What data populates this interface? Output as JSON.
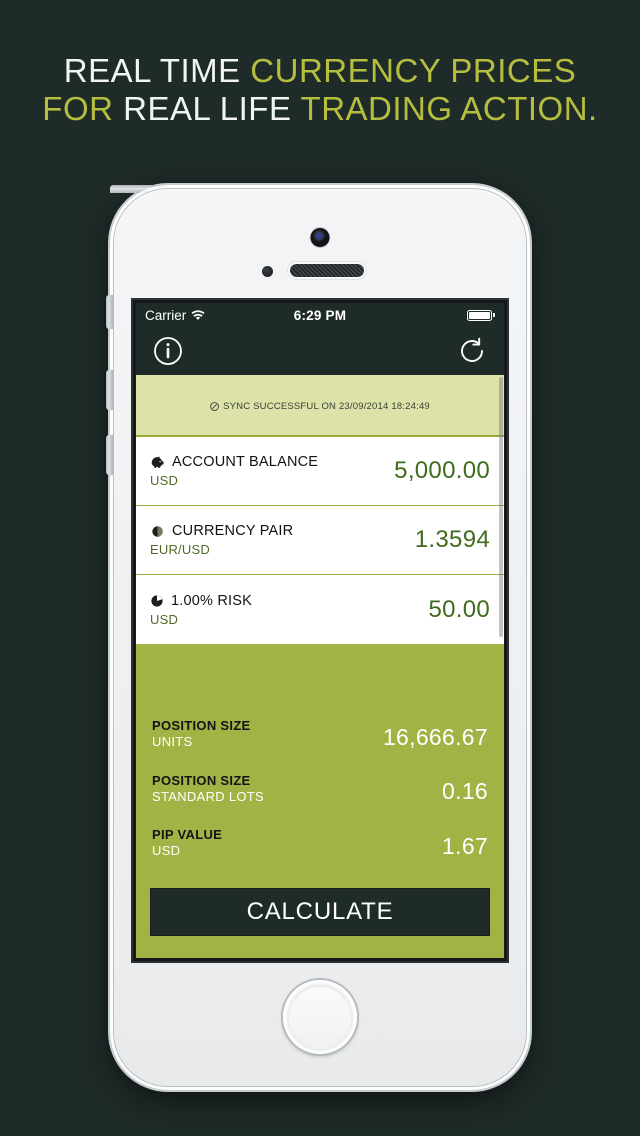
{
  "headline": {
    "line1": [
      {
        "text": "REAL TIME ",
        "color": "white"
      },
      {
        "text": "CURRENCY PRICES",
        "color": "green"
      }
    ],
    "line2": [
      {
        "text": "FOR ",
        "color": "green"
      },
      {
        "text": "REAL LIFE ",
        "color": "white"
      },
      {
        "text": "TRADING ACTION.",
        "color": "green"
      }
    ],
    "line1_plain": "REAL TIME CURRENCY PRICES",
    "line2_plain": "FOR REAL LIFE TRADING ACTION."
  },
  "colors": {
    "background": "#1f2b29",
    "accent_green": "#b5be3e",
    "panel_green": "#a3b244",
    "banner_green": "#dce2a8",
    "value_green": "#3f6b1f",
    "white": "#ffffff"
  },
  "statusbar": {
    "carrier": "Carrier",
    "wifi_icon": "wifi-icon",
    "time": "6:29 PM",
    "battery_icon": "battery-full-icon"
  },
  "navbar": {
    "info_icon": "info-circle-icon",
    "refresh_icon": "refresh-icon"
  },
  "sync": {
    "status_icon": "check-circle-icon",
    "message": "SYNC SUCCESSFUL ON 23/09/2014 18:24:49"
  },
  "inputs": [
    {
      "icon": "piggy-bank-icon",
      "title": "ACCOUNT BALANCE",
      "subtitle": "USD",
      "value": "5,000.00"
    },
    {
      "icon": "currency-circle-icon",
      "title": "CURRENCY PAIR",
      "subtitle": "EUR/USD",
      "value": "1.3594"
    },
    {
      "icon": "pie-chart-icon",
      "title": "1.00% RISK",
      "subtitle": "USD",
      "value": "50.00"
    }
  ],
  "results": [
    {
      "title": "POSITION SIZE",
      "subtitle": "UNITS",
      "value": "16,666.67"
    },
    {
      "title": "POSITION SIZE",
      "subtitle": "STANDARD LOTS",
      "value": "0.16"
    },
    {
      "title": "PIP VALUE",
      "subtitle": "USD",
      "value": "1.67"
    }
  ],
  "calculate_button": {
    "label": "CALCULATE"
  }
}
